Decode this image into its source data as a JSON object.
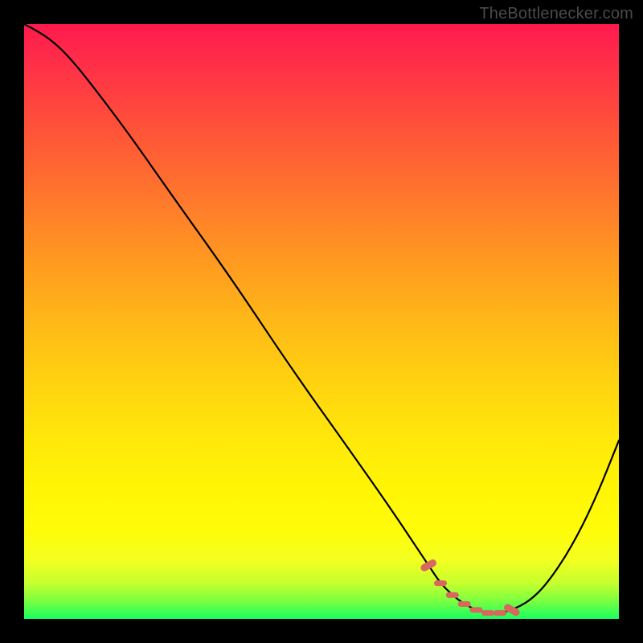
{
  "watermark": "TheBottlenecker.com",
  "chart_data": {
    "type": "line",
    "title": "",
    "xlabel": "",
    "ylabel": "",
    "xlim": [
      0,
      100
    ],
    "ylim": [
      0,
      100
    ],
    "x": [
      0,
      2,
      5,
      8,
      12,
      18,
      25,
      35,
      45,
      55,
      62,
      66,
      68,
      70,
      72,
      74,
      76,
      78,
      80,
      82,
      85,
      88,
      92,
      96,
      100
    ],
    "values": [
      100,
      99,
      97,
      94,
      89,
      81,
      71,
      57,
      42,
      28,
      18,
      12,
      9,
      6,
      4,
      2.5,
      1.5,
      1,
      1,
      1.5,
      3,
      6,
      12,
      20,
      30
    ],
    "colors": {
      "gradient_top": "#ff1a4d",
      "gradient_mid": "#ffd210",
      "gradient_bottom": "#18ff60",
      "curve": "#000000",
      "marker": "#d9675e"
    },
    "grid": false,
    "legend": false,
    "markers": {
      "style": "dashed-segment",
      "positions_x": [
        68,
        70,
        72,
        74,
        76,
        78,
        80,
        82
      ]
    }
  }
}
